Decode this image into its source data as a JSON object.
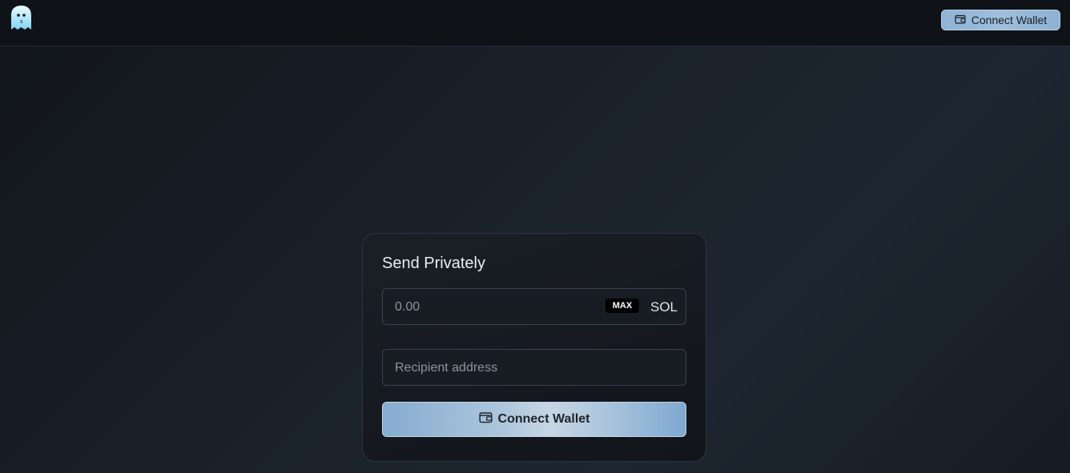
{
  "header": {
    "logo_icon": "ghost-logo-icon",
    "connect_wallet_label": "Connect Wallet",
    "connect_wallet_icon": "wallet-icon"
  },
  "send_card": {
    "title": "Send Privately",
    "amount": {
      "value": "",
      "placeholder": "0.00",
      "max_label": "MAX",
      "unit": "SOL"
    },
    "recipient": {
      "value": "",
      "placeholder": "Recipient address"
    },
    "connect_wallet_label": "Connect Wallet",
    "connect_wallet_icon": "wallet-icon"
  },
  "colors": {
    "background": "#161c23",
    "header": "#0f1317",
    "card": "#171b21",
    "accent": "#9fbfdc"
  }
}
